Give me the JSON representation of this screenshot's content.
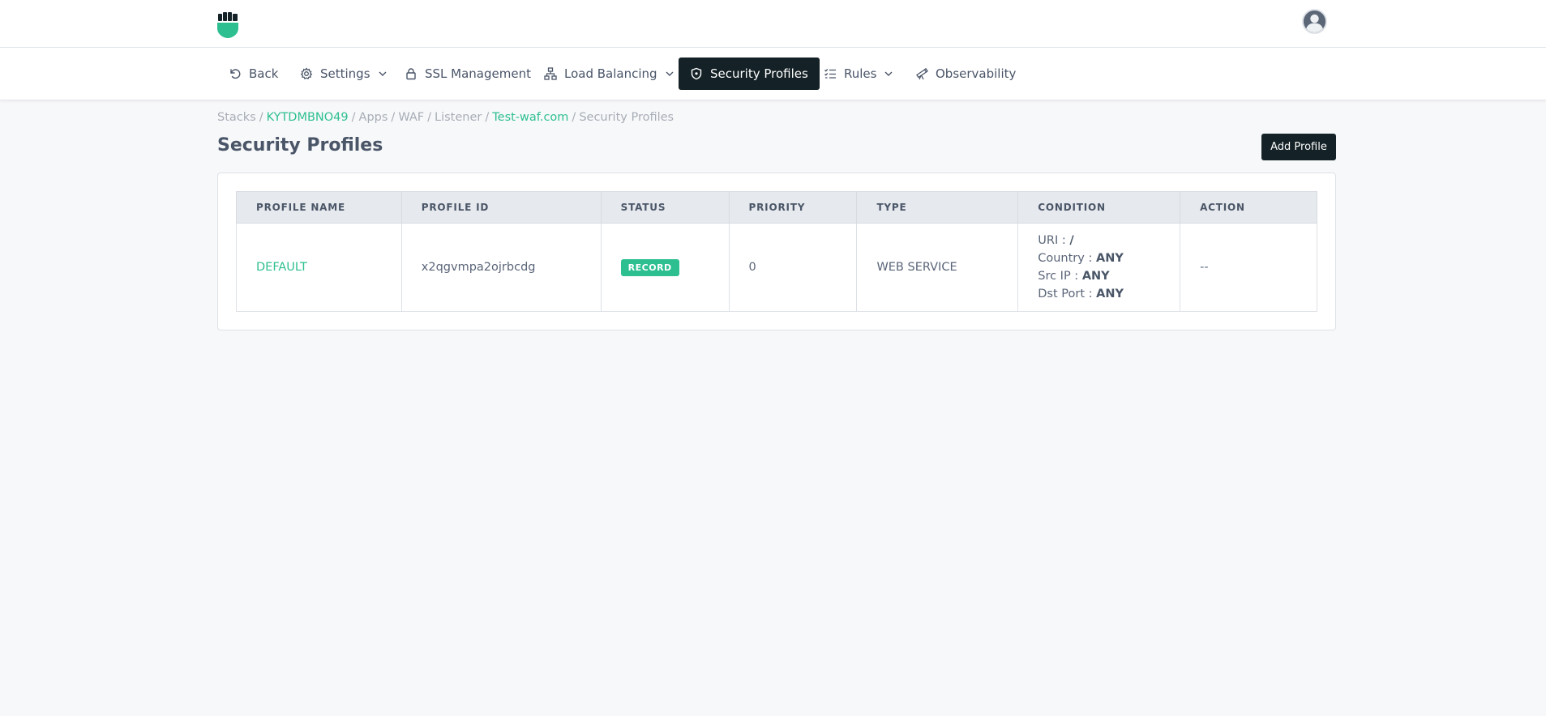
{
  "nav": {
    "back": "Back",
    "settings": "Settings",
    "ssl": "SSL Management",
    "load_balancing": "Load Balancing",
    "security_profiles": "Security Profiles",
    "rules": "Rules",
    "observability": "Observability"
  },
  "breadcrumb": {
    "stacks": "Stacks",
    "stack_id": "KYTDMBNO49",
    "apps": "Apps",
    "waf": "WAF",
    "listener": "Listener",
    "domain": "Test-waf.com",
    "current": "Security Profiles",
    "separator": "/"
  },
  "page": {
    "title": "Security Profiles",
    "add_button": "Add Profile"
  },
  "table": {
    "headers": [
      "PROFILE NAME",
      "PROFILE ID",
      "STATUS",
      "PRIORITY",
      "TYPE",
      "CONDITION",
      "ACTION"
    ],
    "rows": [
      {
        "profile_name": "DEFAULT",
        "profile_id": "x2qgvmpa2ojrbcdg",
        "status": "RECORD",
        "priority": "0",
        "type": "WEB SERVICE",
        "condition": {
          "uri_label": "URI :",
          "uri_value": "/",
          "country_label": "Country :",
          "country_value": "ANY",
          "src_ip_label": "Src IP :",
          "src_ip_value": "ANY",
          "dst_port_label": "Dst Port :",
          "dst_port_value": "ANY"
        },
        "action": "--"
      }
    ]
  },
  "colors": {
    "accent": "#2ebf91",
    "dark": "#142126"
  },
  "icons": {
    "logo": "fist-shield-logo",
    "avatar": "user-avatar",
    "back": "undo-arrow-icon",
    "settings": "gear-icon",
    "ssl": "lock-icon",
    "load_balancing": "network-icon",
    "security_profiles": "shield-icon",
    "rules": "checklist-icon",
    "observability": "telescope-icon",
    "dropdown": "chevron-down-icon"
  }
}
